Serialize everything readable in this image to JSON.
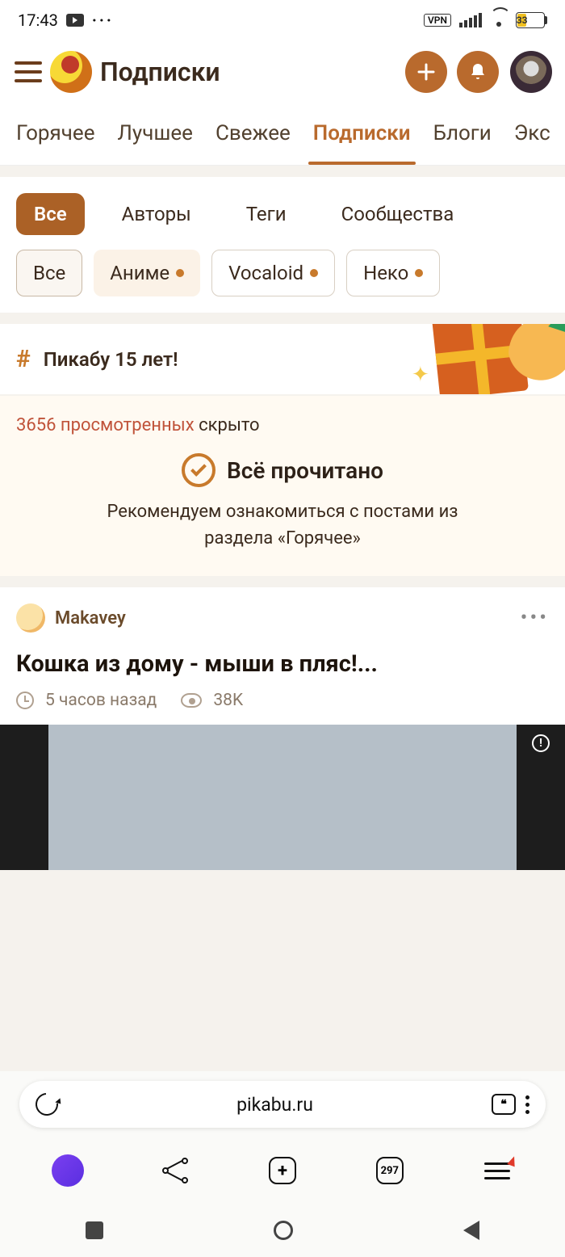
{
  "status": {
    "time": "17:43",
    "vpn": "VPN",
    "battery": "33"
  },
  "header": {
    "title": "Подписки"
  },
  "tabs": [
    {
      "label": "Горячее"
    },
    {
      "label": "Лучшее"
    },
    {
      "label": "Свежее"
    },
    {
      "label": "Подписки"
    },
    {
      "label": "Блоги"
    },
    {
      "label": "Экс"
    }
  ],
  "filters1": {
    "all": "Все",
    "authors": "Авторы",
    "tags": "Теги",
    "communities": "Сообщества"
  },
  "filters2": {
    "all": "Все",
    "anime": "Аниме",
    "vocaloid": "Vocaloid",
    "neko": "Неко"
  },
  "banner": {
    "text": "Пикабу 15 лет!"
  },
  "viewed": {
    "count_text": "3656 просмотренных",
    "hidden": " скрыто",
    "done": "Всё прочитано",
    "recommend_l1": "Рекомендуем ознакомиться с постами из",
    "recommend_l2": "раздела «Горячее»"
  },
  "post": {
    "author": "Makavey",
    "title": "Кошка из дому - мыши в пляс!...",
    "time": "5 часов назад",
    "views": "38K"
  },
  "browser": {
    "url": "pikabu.ru",
    "tabcount": "297"
  }
}
